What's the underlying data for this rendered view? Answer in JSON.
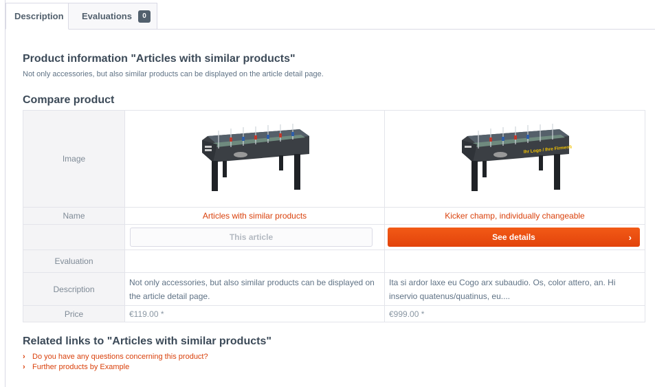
{
  "tabs": {
    "description": "Description",
    "evaluations": "Evaluations",
    "evaluations_count": "0"
  },
  "product_info": {
    "heading": "Product information \"Articles with similar products\"",
    "text": "Not only accessories, but also similar products can be displayed on the article detail page."
  },
  "compare": {
    "heading": "Compare product",
    "labels": {
      "image": "Image",
      "name": "Name",
      "evaluation": "Evaluation",
      "description": "Description",
      "price": "Price"
    },
    "products": [
      {
        "name": "Articles with similar products",
        "button": "This article",
        "description": "Not only accessories, but also similar products can be displayed on the article detail page.",
        "price": "€119.00 *",
        "image_icon": "foosball-table-icon",
        "logo_text": ""
      },
      {
        "name": "Kicker champ, individually changeable",
        "button": "See details",
        "description": "Ita si ardor laxe eu Cogo arx subaudio. Os, color attero, an. Hi inservio quatenus/quatinus, eu....",
        "price": "€999.00 *",
        "image_icon": "foosball-table-icon",
        "logo_text": "Ihr Logo / Ihre Firmenfarben"
      }
    ]
  },
  "related": {
    "heading": "Related links to \"Articles with similar products\"",
    "links": [
      "Do you have any questions concerning this product?",
      "Further products by Example"
    ]
  },
  "colors": {
    "accent": "#e2430b",
    "link": "#d9400b",
    "heading": "#3c4a58",
    "badge": "#52606d"
  }
}
